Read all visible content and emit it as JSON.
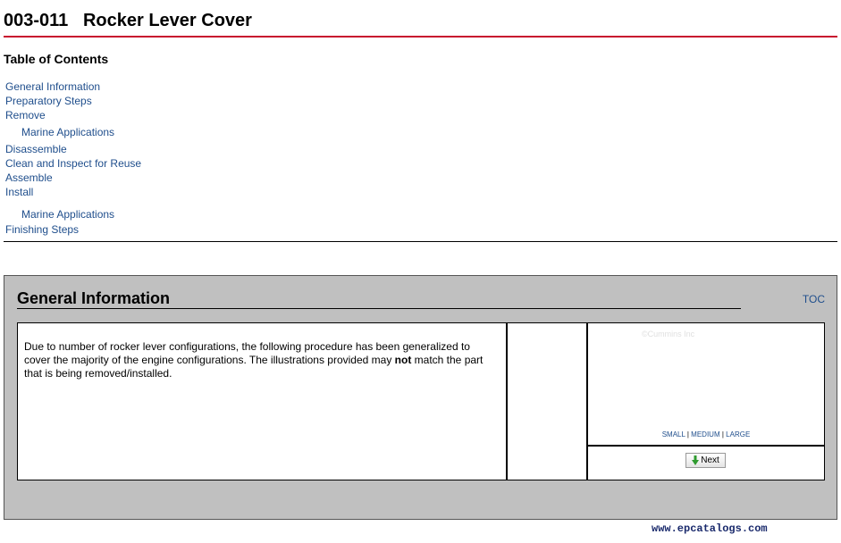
{
  "page": {
    "doc_number": "003-011",
    "title": "Rocker Lever Cover"
  },
  "toc": {
    "heading": "Table of Contents",
    "items": [
      {
        "label": "General Information"
      },
      {
        "label": "Preparatory Steps"
      },
      {
        "label": "Remove"
      },
      {
        "label": "Marine Applications"
      },
      {
        "label": "Disassemble"
      },
      {
        "label": "Clean and Inspect for Reuse"
      },
      {
        "label": "Assemble"
      },
      {
        "label": "Install"
      },
      {
        "label": "Marine Applications"
      },
      {
        "label": "Finishing Steps"
      }
    ]
  },
  "section": {
    "title": "General Information",
    "toc_link": "TOC",
    "text_before": "Due to number of rocker lever configurations, the following procedure has been generalized to cover the majority of the engine configurations. The illustrations provided may ",
    "text_bold": "not",
    "text_after": " match the part that is being removed/installed.",
    "image_copyright": "©Cummins Inc",
    "size_links": {
      "small": "SMALL",
      "medium": "MEDIUM",
      "large": "LARGE",
      "separator": "|"
    },
    "next_label": "Next"
  },
  "footer": {
    "watermark": "www.epcatalogs.com"
  },
  "colors": {
    "title_rule": "#c8102e",
    "link": "#1f4e8c",
    "section_bg": "#c0c0c0",
    "watermark": "#1a2a6c",
    "next_arrow": "#2e9a2e"
  }
}
